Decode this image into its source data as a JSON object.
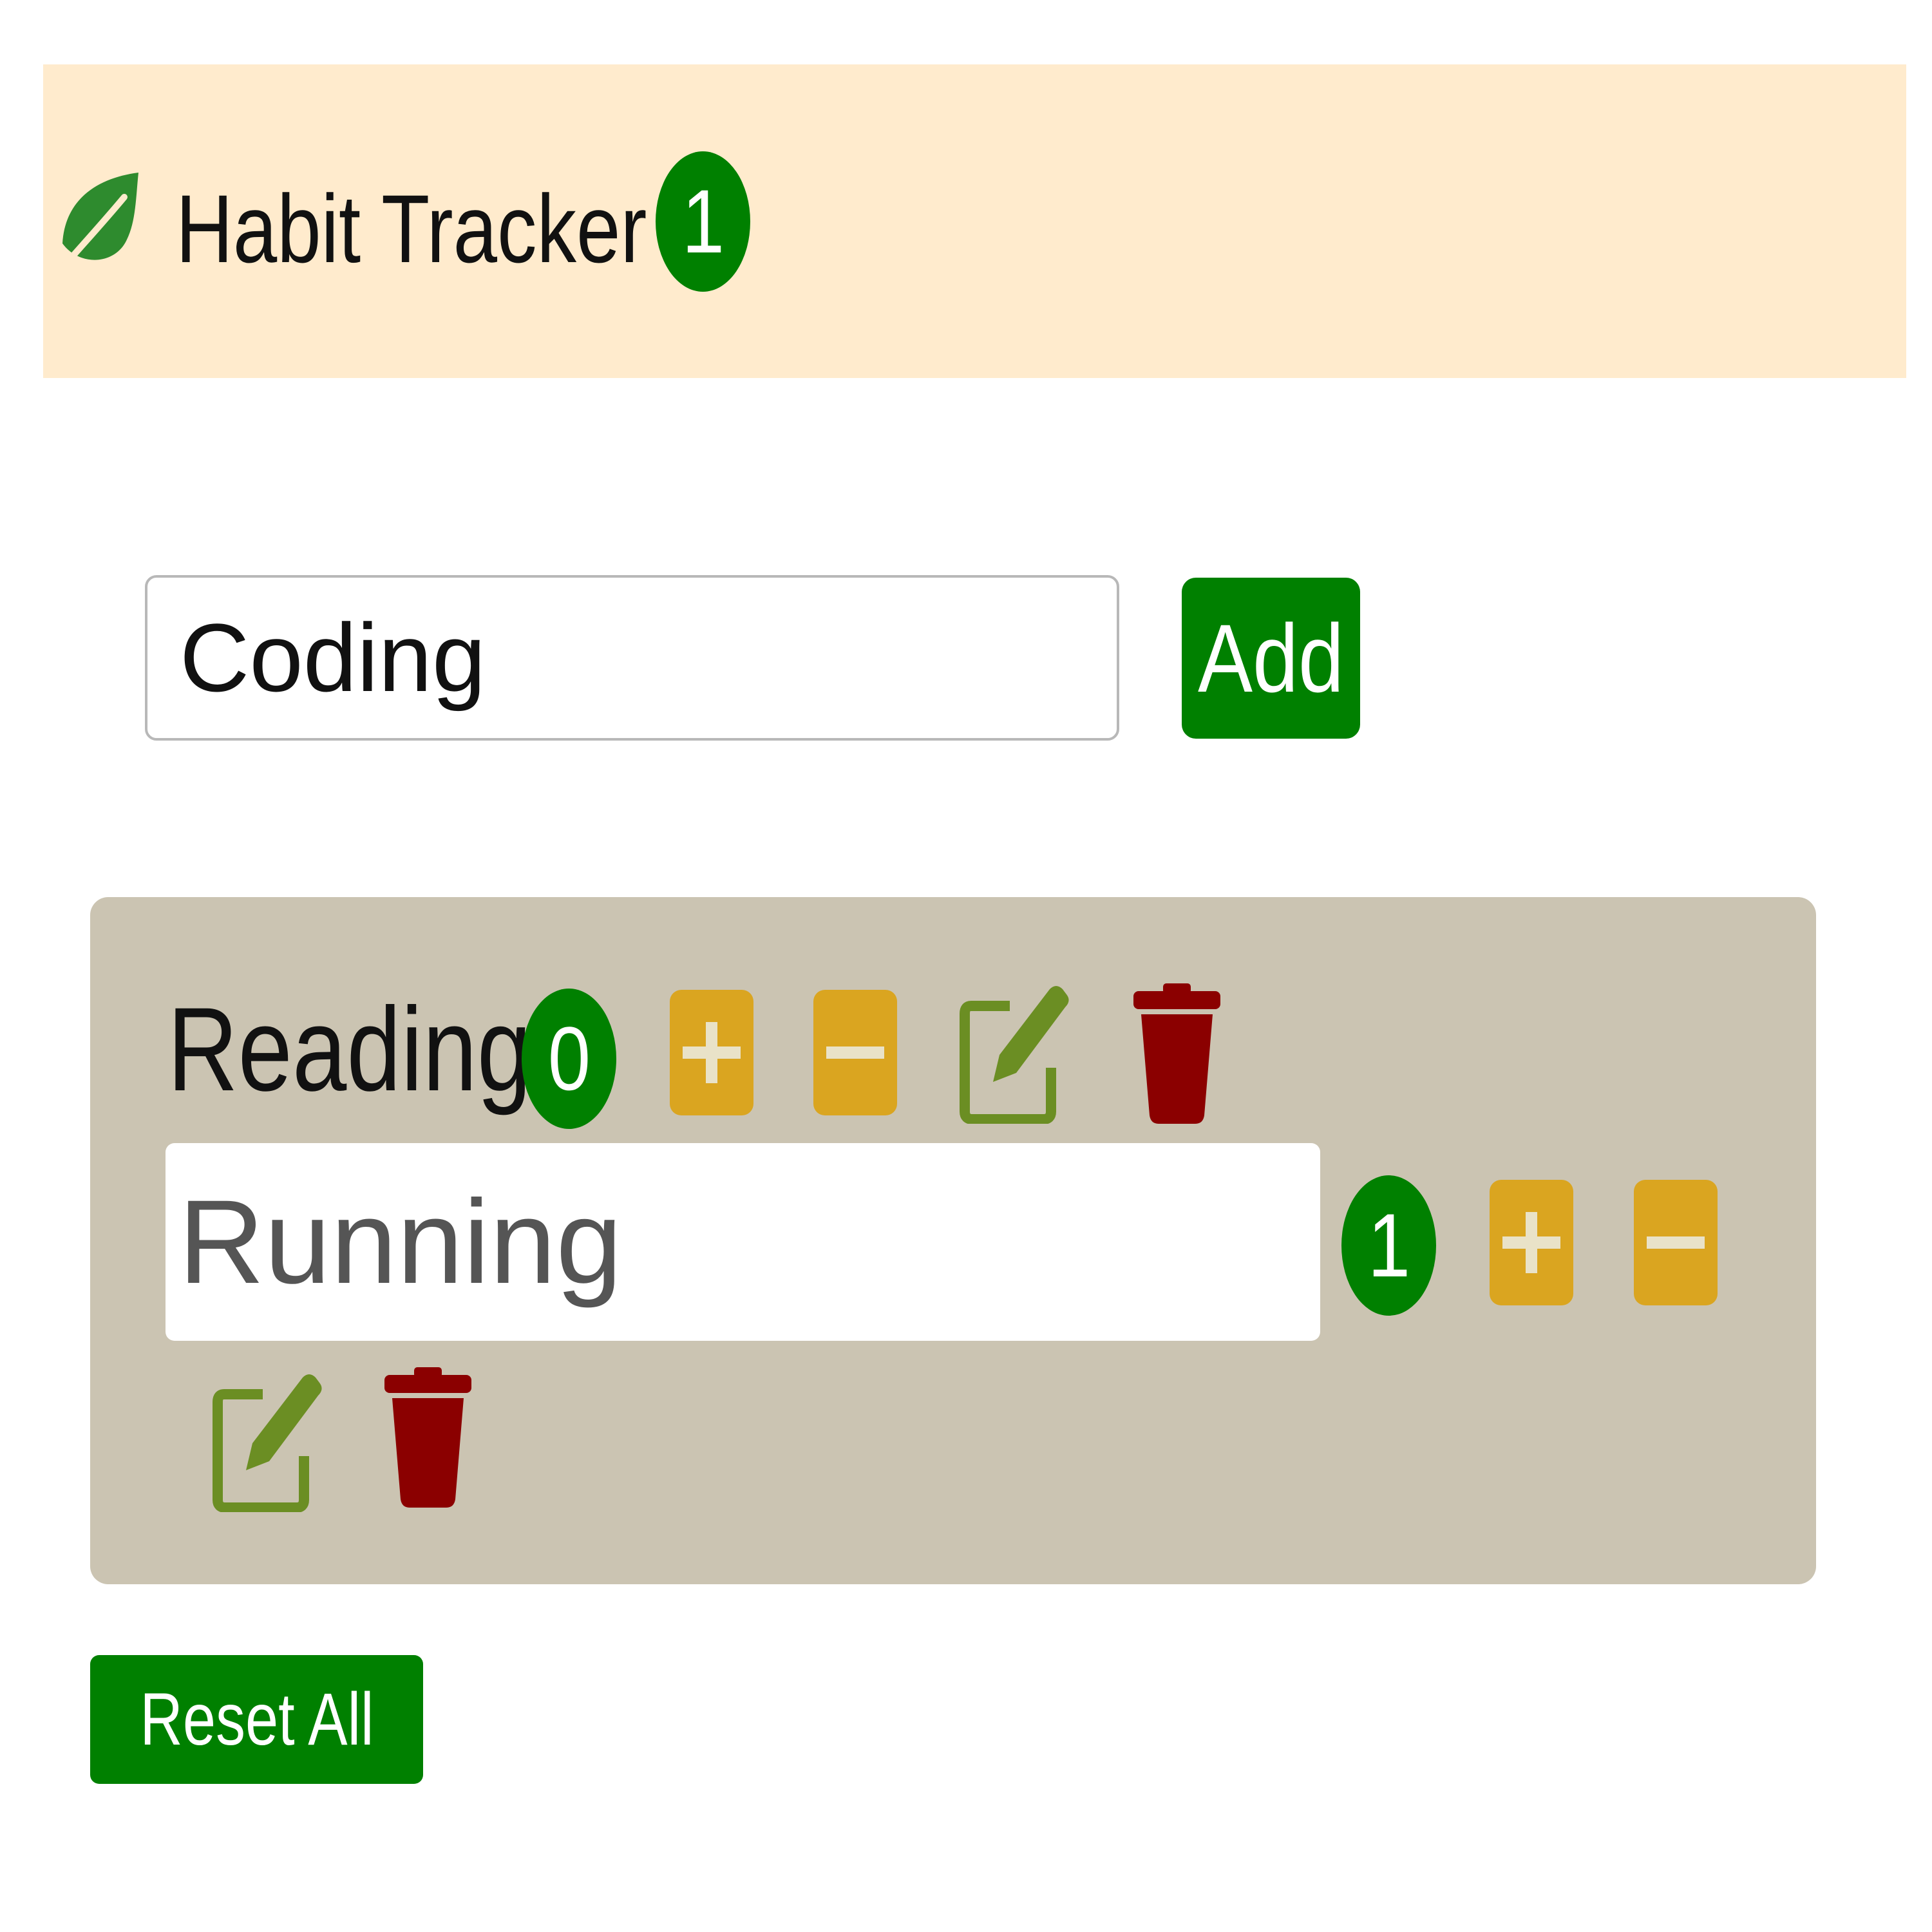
{
  "header": {
    "title": "Habit Tracker",
    "count": "1",
    "icon": "leaf-icon"
  },
  "add_form": {
    "input_value": "Coding",
    "add_label": "Add"
  },
  "habits": [
    {
      "name": "Reading",
      "count": "0",
      "editing": false,
      "icons": [
        "plus-square-icon",
        "minus-square-icon",
        "edit-icon",
        "trash-icon"
      ]
    },
    {
      "name": "Running",
      "count": "1",
      "editing": true,
      "icons": [
        "plus-square-icon",
        "minus-square-icon",
        "edit-icon",
        "trash-icon"
      ]
    }
  ],
  "reset_label": "Reset All",
  "colors": {
    "header_bg": "#ffebcd",
    "primary_green": "#008000",
    "card_bg": "#cbc4b2",
    "increment_color": "#daa520",
    "edit_color": "#6b8e23",
    "delete_color": "#8b0000"
  }
}
